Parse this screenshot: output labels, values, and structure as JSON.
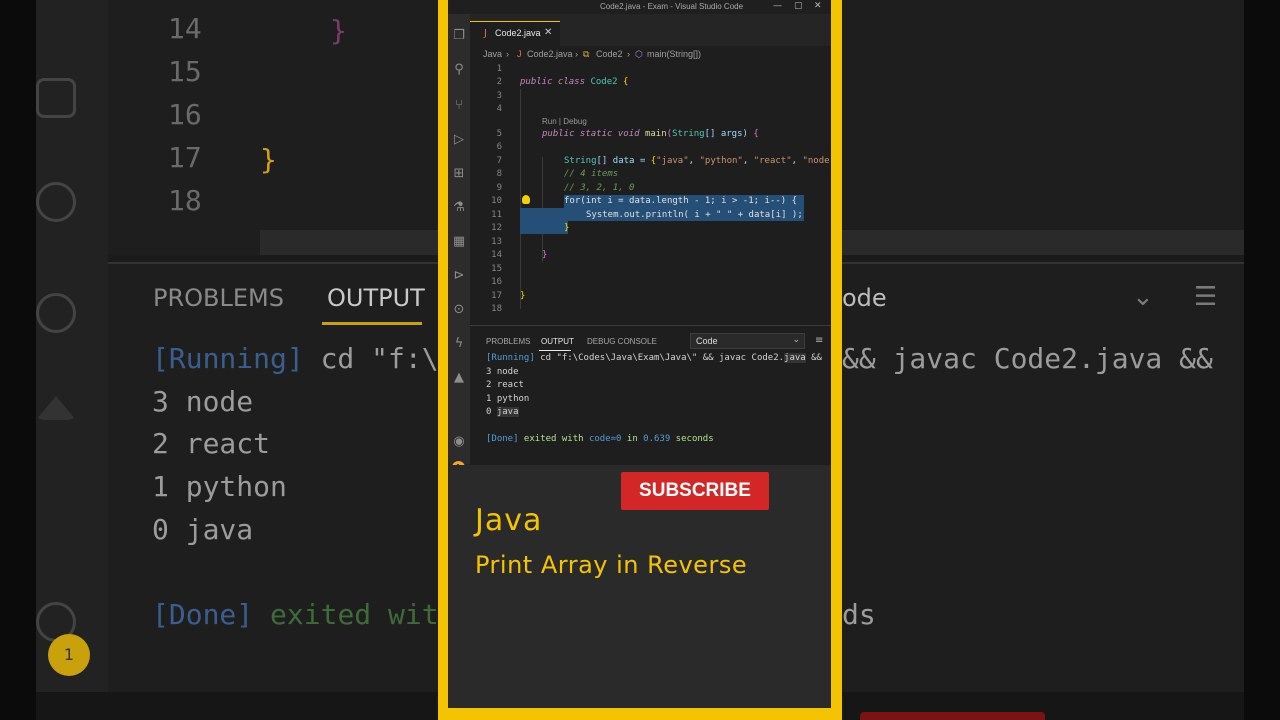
{
  "background": {
    "line_numbers": [
      "14",
      "15",
      "16",
      "17",
      "18"
    ],
    "panel_tabs": [
      "PROBLEMS",
      "OUTPUT"
    ],
    "right_tab_fragment": "ode",
    "output": {
      "running_tag": "[Running]",
      "running_cmd": " cd \"f:\\",
      "running_tail": "&& javac Code2.java && ",
      "lines": [
        "3 node",
        "2 react",
        "1 python",
        "0 java"
      ],
      "done_tag": "[Done]",
      "done_text": " exited wit",
      "done_tail": "ds"
    },
    "badge": "1"
  },
  "window": {
    "title": "Code2.java - Exam - Visual Studio Code",
    "controls": [
      "—",
      "▢",
      "✕"
    ]
  },
  "tab": {
    "icon": "J",
    "label": "Code2.java",
    "close": "✕"
  },
  "breadcrumb": [
    "Java",
    "›",
    "J",
    "Code2.java",
    "›",
    "Code2",
    "›",
    "main(String[])"
  ],
  "editor": {
    "line_numbers": [
      "1",
      "2",
      "3",
      "4",
      "5",
      "6",
      "7",
      "8",
      "9",
      "10",
      "11",
      "12",
      "13",
      "14",
      "15",
      "16",
      "17",
      "18"
    ],
    "codelens": "Run | Debug",
    "code": {
      "l2_kw": "public class",
      "l2_name": " Code2 ",
      "l2_brace": "{",
      "l5_kw": "public static void",
      "l5_fn": " main",
      "l5_paren": "(",
      "l5_type": "String",
      "l5_rest": "[] args) ",
      "l5_brace": "{",
      "l7_type": "String",
      "l7_mid": "[] data = ",
      "l7_brace": "{",
      "l7_s1": "\"java\"",
      "l7_s2": "\"python\"",
      "l7_s3": "\"react\"",
      "l7_s4": "\"node",
      "l8_comment": "// 4 items",
      "l9_comment": "// 3, 2, 1, 0",
      "l10": "for(int i = data.length - 1; i > -1; i--) {",
      "l11": "System.out.println( i + \" \" + data[i] );",
      "l12": "}",
      "l14": "}",
      "l17": "}"
    }
  },
  "panel": {
    "tabs": [
      "PROBLEMS",
      "OUTPUT",
      "DEBUG CONSOLE"
    ],
    "active_tab": "OUTPUT",
    "dropdown_value": "Code",
    "menu_icon": "≡",
    "output": {
      "running_tag": "[Running]",
      "running_cmd": " cd \"f:\\Codes\\Java\\Exam\\Java\\\" && javac Code2.",
      "running_java": "java",
      "running_tail": " &&",
      "lines": [
        "3 node",
        "2 react",
        "1 python",
        "0 "
      ],
      "last_word": "java",
      "done_tag": "[Done]",
      "done_text": " exited with ",
      "done_code": "code=0",
      "done_in": " in ",
      "done_time": "0.639",
      "done_tail": " seconds"
    }
  },
  "promo": {
    "subscribe": "SUBSCRIBE",
    "title": "Java",
    "subtitle": "Print Array in Reverse"
  },
  "activity_badge": "1",
  "colors": {
    "frame": "#f5c400",
    "subscribe": "#d32727",
    "accent_text": "#f5c400"
  }
}
